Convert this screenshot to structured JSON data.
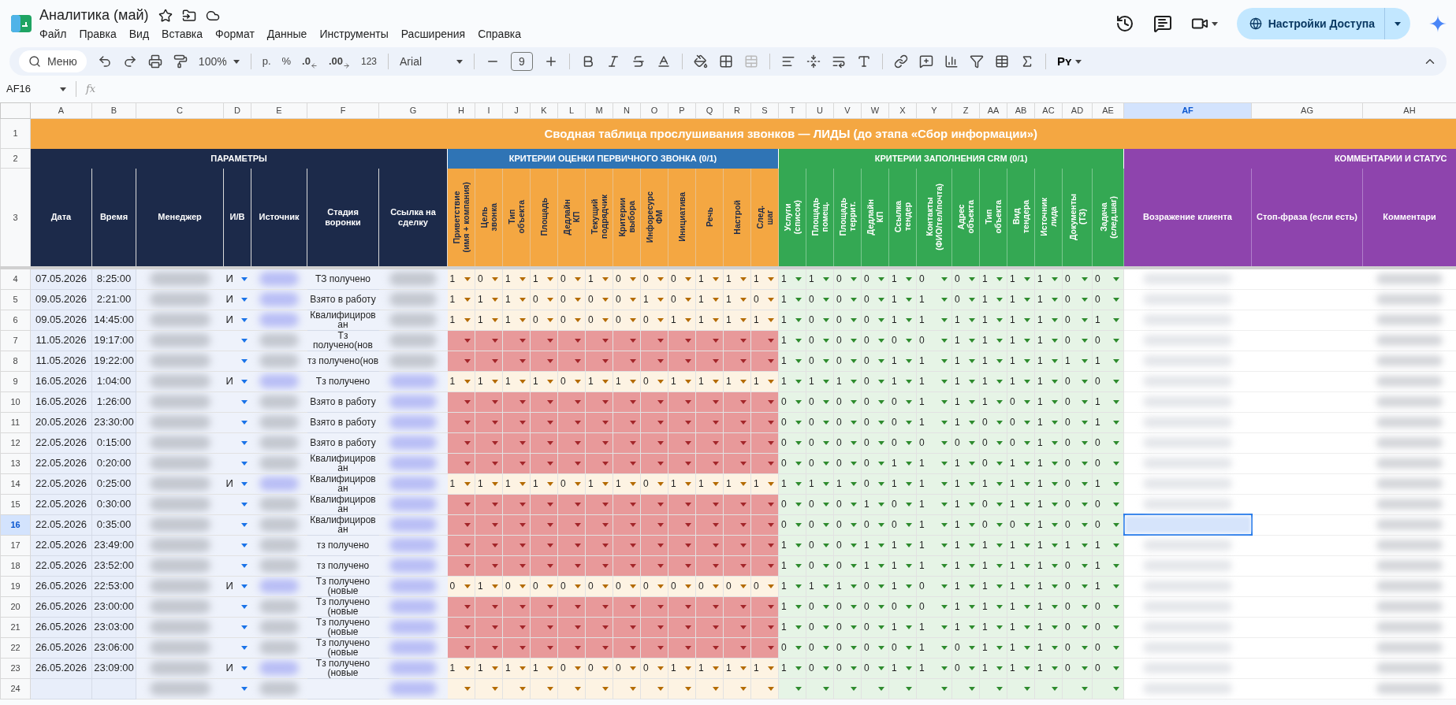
{
  "doc": {
    "title": "Аналитика (май)"
  },
  "menu": [
    "Файл",
    "Правка",
    "Вид",
    "Вставка",
    "Формат",
    "Данные",
    "Инструменты",
    "Расширения",
    "Справка"
  ],
  "share": {
    "label": "Настройки Доступа"
  },
  "toolbar": {
    "search": "Меню",
    "zoom": "100%",
    "currency": "р.",
    "percent": "%",
    "dec_less": ".0",
    "dec_more": ".00",
    "number_format": "123",
    "font": "Arial",
    "font_size": "9",
    "py": "Pʏ"
  },
  "formula_bar": {
    "cell": "AF16",
    "fx": "fx"
  },
  "columns": [
    {
      "letter": "A",
      "selected": false
    },
    {
      "letter": "B",
      "selected": false
    },
    {
      "letter": "C",
      "selected": false
    },
    {
      "letter": "D",
      "selected": false
    },
    {
      "letter": "E",
      "selected": false
    },
    {
      "letter": "F",
      "selected": false
    },
    {
      "letter": "G",
      "selected": false
    },
    {
      "letter": "H",
      "selected": false
    },
    {
      "letter": "I",
      "selected": false
    },
    {
      "letter": "J",
      "selected": false
    },
    {
      "letter": "K",
      "selected": false
    },
    {
      "letter": "L",
      "selected": false
    },
    {
      "letter": "M",
      "selected": false
    },
    {
      "letter": "N",
      "selected": false
    },
    {
      "letter": "O",
      "selected": false
    },
    {
      "letter": "P",
      "selected": false
    },
    {
      "letter": "Q",
      "selected": false
    },
    {
      "letter": "R",
      "selected": false
    },
    {
      "letter": "S",
      "selected": false
    },
    {
      "letter": "T",
      "selected": false
    },
    {
      "letter": "U",
      "selected": false
    },
    {
      "letter": "V",
      "selected": false
    },
    {
      "letter": "W",
      "selected": false
    },
    {
      "letter": "X",
      "selected": false
    },
    {
      "letter": "Y",
      "selected": false
    },
    {
      "letter": "Z",
      "selected": false
    },
    {
      "letter": "AA",
      "selected": false
    },
    {
      "letter": "AB",
      "selected": false
    },
    {
      "letter": "AC",
      "selected": false
    },
    {
      "letter": "AD",
      "selected": false
    },
    {
      "letter": "AE",
      "selected": false
    },
    {
      "letter": "AF",
      "selected": true
    },
    {
      "letter": "AG",
      "selected": false
    },
    {
      "letter": "AH",
      "selected": false
    }
  ],
  "header_rows": [
    {
      "n": "1"
    },
    {
      "n": "2"
    },
    {
      "n": "3"
    }
  ],
  "sheet_title": "Сводная таблица прослушивания звонков — ЛИДЫ (до этапа «Сбор информации»)",
  "groups": {
    "params": "ПАРАМЕТРЫ",
    "call": "КРИТЕРИИ ОЦЕНКИ ПЕРВИЧНОГО ЗВОНКА (0/1)",
    "crm": "КРИТЕРИИ ЗАПОЛНЕНИЯ CRM (0/1)",
    "comments": "КОММЕНТАРИИ И СТАТУС"
  },
  "param_headers": [
    "Дата",
    "Время",
    "Менеджер",
    "И/В",
    "Источник",
    "Стадия\nворонки",
    "Ссылка на\nсделку"
  ],
  "call_headers": [
    "Приветствие\n(имя + компания)",
    "Цель\nзвонка",
    "Тип\nобъекта",
    "Площадь",
    "Дедлайн\nКП",
    "Текущий\nподрядчик",
    "Критерии\nвыбора",
    "Инфоресурс\nФМ",
    "Инициатива",
    "Речь",
    "Настрой",
    "След.\nшаг"
  ],
  "crm_headers": [
    "Услуги\n(список)",
    "Площадь\nпомещ.",
    "Площадь\nтеррит.",
    "Дедлайн\nКП",
    "Ссылка\nтендер",
    "Контакты\n(ФИО/тел/почта)",
    "Адрес\nобъекта",
    "Тип\nобъекта",
    "Вид\nтендера",
    "Источник\nлида",
    "Документы\n(ТЗ)",
    "Задача\n(след.шаг)"
  ],
  "comment_headers": [
    "Возражение клиента",
    "Стоп-фраза (если есть)",
    "Комментари"
  ],
  "rows": [
    {
      "n": "4",
      "selected": false,
      "date": "07.05.2026",
      "time": "8:25:00",
      "iv": "И",
      "stage": "ТЗ получено",
      "flagged": false,
      "call": [
        "1",
        "0",
        "1",
        "1",
        "0",
        "1",
        "0",
        "0",
        "0",
        "1",
        "1",
        "1"
      ],
      "crm": [
        "1",
        "1",
        "0",
        "0",
        "1",
        "0",
        "0",
        "1",
        "1",
        "1",
        "0",
        "0"
      ]
    },
    {
      "n": "5",
      "selected": false,
      "date": "09.05.2026",
      "time": "2:21:00",
      "iv": "И",
      "stage": "Взято в работу",
      "flagged": false,
      "call": [
        "1",
        "1",
        "1",
        "0",
        "0",
        "0",
        "0",
        "1",
        "0",
        "1",
        "1",
        "0"
      ],
      "crm": [
        "1",
        "0",
        "0",
        "0",
        "1",
        "1",
        "0",
        "1",
        "1",
        "1",
        "0",
        "0"
      ]
    },
    {
      "n": "6",
      "selected": false,
      "date": "09.05.2026",
      "time": "14:45:00",
      "iv": "И",
      "stage": "Квалифициров ан",
      "flagged": false,
      "call": [
        "1",
        "1",
        "1",
        "0",
        "0",
        "0",
        "0",
        "0",
        "1",
        "1",
        "1",
        "1"
      ],
      "crm": [
        "1",
        "0",
        "0",
        "0",
        "1",
        "1",
        "1",
        "1",
        "1",
        "1",
        "0",
        "1"
      ]
    },
    {
      "n": "7",
      "selected": false,
      "date": "11.05.2026",
      "time": "19:17:00",
      "stage": "Тз получено(нов",
      "flagged": true,
      "call": [],
      "crm": [
        "1",
        "0",
        "0",
        "0",
        "0",
        "0",
        "1",
        "1",
        "1",
        "1",
        "0",
        "0"
      ]
    },
    {
      "n": "8",
      "selected": false,
      "date": "11.05.2026",
      "time": "19:22:00",
      "stage": "тз получено(нов",
      "flagged": true,
      "call": [],
      "crm": [
        "1",
        "0",
        "0",
        "0",
        "1",
        "1",
        "1",
        "1",
        "1",
        "1",
        "1",
        "1"
      ]
    },
    {
      "n": "9",
      "selected": false,
      "date": "16.05.2026",
      "time": "1:04:00",
      "iv": "И",
      "stage": "Тз получено",
      "flagged": false,
      "call": [
        "1",
        "1",
        "1",
        "1",
        "0",
        "1",
        "1",
        "0",
        "1",
        "1",
        "1",
        "1"
      ],
      "crm": [
        "1",
        "1",
        "1",
        "0",
        "1",
        "1",
        "1",
        "1",
        "1",
        "1",
        "0",
        "0"
      ]
    },
    {
      "n": "10",
      "selected": false,
      "date": "16.05.2026",
      "time": "1:26:00",
      "stage": "Взято в работу",
      "flagged": true,
      "call": [],
      "crm": [
        "0",
        "0",
        "0",
        "0",
        "0",
        "1",
        "1",
        "1",
        "0",
        "1",
        "0",
        "1"
      ]
    },
    {
      "n": "11",
      "selected": false,
      "date": "20.05.2026",
      "time": "23:30:00",
      "stage": "Взято в работу",
      "flagged": true,
      "call": [],
      "crm": [
        "0",
        "0",
        "0",
        "0",
        "0",
        "1",
        "1",
        "0",
        "0",
        "1",
        "0",
        "1"
      ]
    },
    {
      "n": "12",
      "selected": false,
      "date": "22.05.2026",
      "time": "0:15:00",
      "stage": "Взято в работу",
      "flagged": true,
      "call": [],
      "crm": [
        "0",
        "0",
        "0",
        "0",
        "0",
        "0",
        "0",
        "0",
        "0",
        "1",
        "0",
        "0"
      ]
    },
    {
      "n": "13",
      "selected": false,
      "date": "22.05.2026",
      "time": "0:20:00",
      "stage": "Квалифициров ан",
      "flagged": true,
      "call": [],
      "crm": [
        "0",
        "0",
        "0",
        "0",
        "1",
        "1",
        "1",
        "0",
        "1",
        "1",
        "0",
        "0"
      ]
    },
    {
      "n": "14",
      "selected": false,
      "date": "22.05.2026",
      "time": "0:25:00",
      "iv": "И",
      "stage": "Квалифициров ан",
      "flagged": false,
      "call": [
        "1",
        "1",
        "1",
        "1",
        "0",
        "1",
        "1",
        "0",
        "1",
        "1",
        "1",
        "1"
      ],
      "crm": [
        "1",
        "1",
        "1",
        "0",
        "1",
        "1",
        "1",
        "1",
        "1",
        "1",
        "0",
        "1"
      ]
    },
    {
      "n": "15",
      "selected": false,
      "date": "22.05.2026",
      "time": "0:30:00",
      "stage": "Квалифициров ан",
      "flagged": true,
      "call": [],
      "crm": [
        "0",
        "0",
        "0",
        "1",
        "0",
        "1",
        "1",
        "0",
        "1",
        "1",
        "0",
        "0"
      ]
    },
    {
      "n": "16",
      "selected": true,
      "date": "22.05.2026",
      "time": "0:35:00",
      "stage": "Квалифициров ан",
      "flagged": true,
      "call": [],
      "crm": [
        "0",
        "0",
        "0",
        "0",
        "0",
        "1",
        "1",
        "0",
        "0",
        "1",
        "0",
        "0"
      ]
    },
    {
      "n": "17",
      "selected": false,
      "date": "22.05.2026",
      "time": "23:49:00",
      "stage": "тз получено",
      "flagged": true,
      "call": [],
      "crm": [
        "1",
        "0",
        "0",
        "1",
        "1",
        "1",
        "1",
        "1",
        "1",
        "1",
        "1",
        "1"
      ]
    },
    {
      "n": "18",
      "selected": false,
      "date": "22.05.2026",
      "time": "23:52:00",
      "stage": "тз получено",
      "flagged": true,
      "call": [],
      "crm": [
        "1",
        "0",
        "0",
        "1",
        "1",
        "1",
        "1",
        "1",
        "1",
        "1",
        "0",
        "1"
      ]
    },
    {
      "n": "19",
      "selected": false,
      "date": "26.05.2026",
      "time": "22:53:00",
      "iv": "И",
      "stage": "Тз получено (новые",
      "flagged": false,
      "call": [
        "0",
        "1",
        "0",
        "0",
        "0",
        "0",
        "0",
        "0",
        "0",
        "0",
        "0",
        "0"
      ],
      "crm": [
        "1",
        "1",
        "1",
        "0",
        "1",
        "0",
        "1",
        "1",
        "1",
        "1",
        "0",
        "1"
      ]
    },
    {
      "n": "20",
      "selected": false,
      "date": "26.05.2026",
      "time": "23:00:00",
      "stage": "Тз получено (новые",
      "flagged": true,
      "call": [],
      "crm": [
        "1",
        "0",
        "0",
        "0",
        "0",
        "0",
        "1",
        "1",
        "1",
        "1",
        "0",
        "0"
      ]
    },
    {
      "n": "21",
      "selected": false,
      "date": "26.05.2026",
      "time": "23:03:00",
      "stage": "Тз получено (новые",
      "flagged": true,
      "call": [],
      "crm": [
        "1",
        "0",
        "0",
        "0",
        "1",
        "1",
        "1",
        "1",
        "1",
        "1",
        "0",
        "0"
      ]
    },
    {
      "n": "22",
      "selected": false,
      "date": "26.05.2026",
      "time": "23:06:00",
      "stage": "Тз получено (новые",
      "flagged": true,
      "call": [],
      "crm": [
        "0",
        "0",
        "0",
        "0",
        "0",
        "1",
        "0",
        "1",
        "1",
        "1",
        "0",
        "0"
      ]
    },
    {
      "n": "23",
      "selected": false,
      "date": "26.05.2026",
      "time": "23:09:00",
      "iv": "И",
      "stage": "Тз получено (новые",
      "flagged": false,
      "call": [
        "1",
        "1",
        "1",
        "1",
        "0",
        "0",
        "0",
        "0",
        "1",
        "1",
        "1",
        "1"
      ],
      "crm": [
        "1",
        "0",
        "0",
        "0",
        "1",
        "1",
        "0",
        "1",
        "1",
        "1",
        "0",
        "0"
      ]
    },
    {
      "n": "24",
      "selected": false,
      "flagged": false,
      "call": [],
      "crm": []
    }
  ]
}
